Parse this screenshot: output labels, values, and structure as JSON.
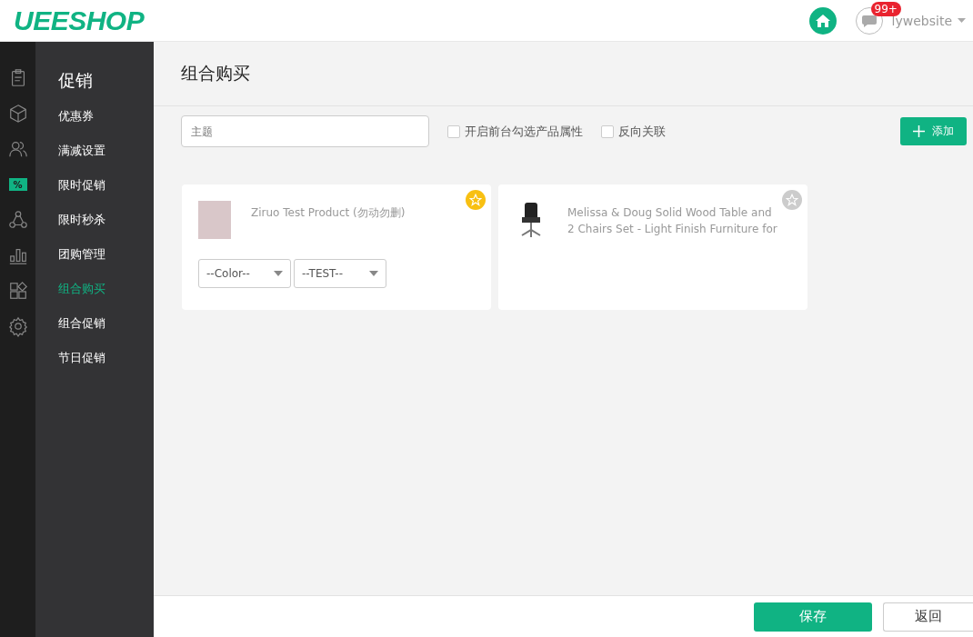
{
  "header": {
    "logo": "UEESHOP",
    "badge": "99+",
    "user": "lywebsite"
  },
  "rail": [
    {
      "selected": false
    },
    {
      "selected": false
    },
    {
      "selected": false
    },
    {
      "selected": true,
      "glyph": "%"
    },
    {
      "selected": false
    },
    {
      "selected": false
    },
    {
      "selected": false
    },
    {
      "selected": false
    }
  ],
  "sidebar": {
    "title": "促销",
    "items": [
      {
        "label": "优惠券",
        "selected": false
      },
      {
        "label": "满减设置",
        "selected": false
      },
      {
        "label": "限时促销",
        "selected": false
      },
      {
        "label": "限时秒杀",
        "selected": false
      },
      {
        "label": "团购管理",
        "selected": false
      },
      {
        "label": "组合购买",
        "selected": true
      },
      {
        "label": "组合促销",
        "selected": false
      },
      {
        "label": "节日促销",
        "selected": false
      }
    ]
  },
  "page_title": "组合购买",
  "toolbar": {
    "placeholder": "主题",
    "checkboxes": [
      {
        "label": "开启前台勾选产品属性",
        "checked": false
      },
      {
        "label": "反向关联",
        "checked": false
      }
    ],
    "add": "添加"
  },
  "products": [
    {
      "name": "Ziruo Test Product (勿动勿删)",
      "main": true,
      "kind": "photo",
      "options": [
        "--Color--",
        "--TEST--"
      ]
    },
    {
      "name": "Melissa & Doug Solid Wood Table and 2 Chairs Set - Light Finish Furniture for",
      "main": false,
      "kind": "chair"
    }
  ],
  "footer": {
    "save": "保存",
    "back": "返回"
  }
}
